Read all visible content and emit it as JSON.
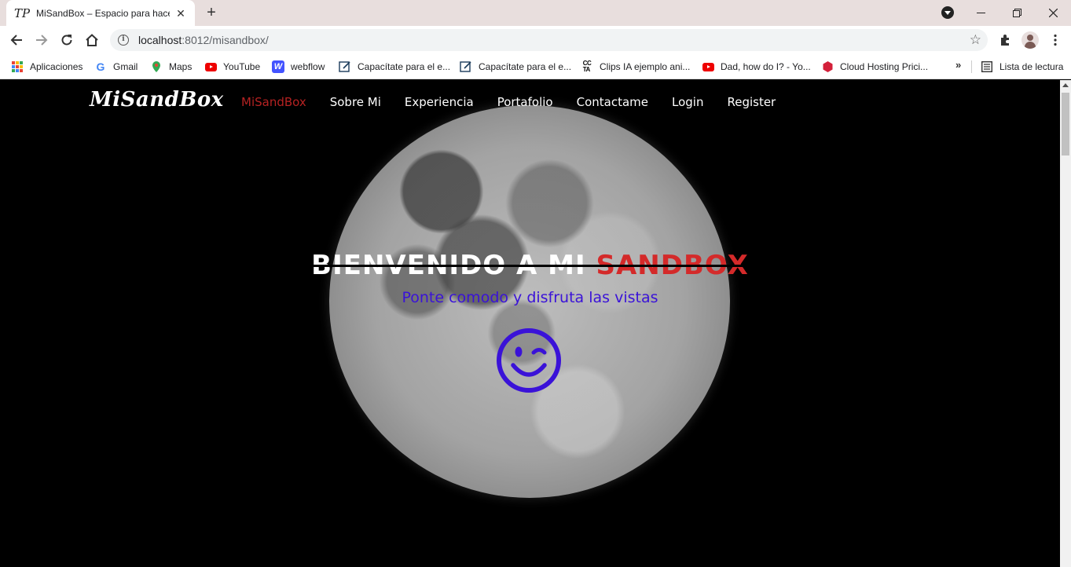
{
  "browser": {
    "tab_title": "MiSandBox – Espacio para hacer",
    "tab_favicon": "TP",
    "url_host": "localhost",
    "url_rest": ":8012/misandbox/",
    "bookmarks": [
      {
        "label": "Aplicaciones",
        "icon": "apps-icon"
      },
      {
        "label": "Gmail",
        "icon": "google-icon"
      },
      {
        "label": "Maps",
        "icon": "maps-icon"
      },
      {
        "label": "YouTube",
        "icon": "youtube-icon"
      },
      {
        "label": "webflow",
        "icon": "webflow-icon"
      },
      {
        "label": "Capacítate para el e...",
        "icon": "edit-icon"
      },
      {
        "label": "Capacítate para el e...",
        "icon": "edit-icon"
      },
      {
        "label": "Clips IA ejemplo ani...",
        "icon": "cc-icon"
      },
      {
        "label": "Dad, how do I? - Yo...",
        "icon": "youtube-icon"
      },
      {
        "label": "Cloud Hosting Prici...",
        "icon": "hexagon-icon"
      }
    ],
    "reading_list": "Lista de lectura"
  },
  "site": {
    "logo": "MiSandBox",
    "nav": [
      "MiSandBox",
      "Sobre Mi",
      "Experiencia",
      "Portafolio",
      "Contactame",
      "Login",
      "Register"
    ],
    "hero_title_white": "BIENVENIDO A MI ",
    "hero_title_red": "SANDBOX",
    "hero_subtitle": "Ponte comodo y disfruta las vistas"
  },
  "colors": {
    "nav_active": "#b52222",
    "title_accent": "#d42a2a",
    "subtitle": "#3a12d8"
  }
}
